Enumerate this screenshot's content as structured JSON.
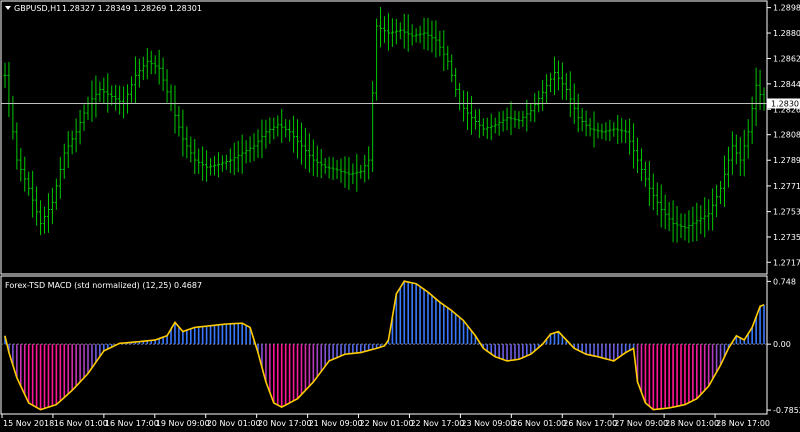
{
  "symbol_header": {
    "symbol": "GBPUSD,H1",
    "ohlc": "1.28327 1.28349 1.28269 1.28301"
  },
  "indicator_header": "Forex-TSD MACD (std normalized) (12,25) 0.4687",
  "price_scale": {
    "ticks": [
      "1.28980",
      "1.28800",
      "1.28620",
      "1.28440",
      "1.28260",
      "1.28080",
      "1.27899",
      "1.27717",
      "1.27535",
      "1.27355",
      "1.27176"
    ],
    "current_price": "1.28301",
    "ylim": [
      1.271,
      1.2902
    ]
  },
  "indicator_scale": {
    "ticks": [
      "0.748",
      "0.00",
      "-0.7852"
    ],
    "ylim": [
      -0.82,
      0.8
    ]
  },
  "time_axis": {
    "labels": [
      "15 Nov 2018",
      "16 Nov 01:00",
      "16 Nov 17:00",
      "19 Nov 09:00",
      "20 Nov 01:00",
      "20 Nov 17:00",
      "21 Nov 09:00",
      "22 Nov 01:00",
      "22 Nov 17:00",
      "23 Nov 09:00",
      "26 Nov 01:00",
      "26 Nov 17:00",
      "27 Nov 09:00",
      "28 Nov 01:00",
      "28 Nov 17:00"
    ]
  },
  "colors": {
    "background": "#000000",
    "bars": "#00c800",
    "frame": "#ffffff",
    "current_line": "#c0c0c0",
    "signal": "#ffcc00",
    "hist_positive": "#3a78ff",
    "hist_negative": "#ff1493",
    "zero_line": "#808080",
    "scale_bg": "#ffffff"
  },
  "chart_data": [
    {
      "type": "ohlc",
      "series": [
        {
          "name": "GBPUSD,H1",
          "anchors": [
            [
              0,
              1.285
            ],
            [
              3,
              1.279
            ],
            [
              6,
              1.277
            ],
            [
              9,
              1.2745
            ],
            [
              12,
              1.276
            ],
            [
              15,
              1.2795
            ],
            [
              18,
              1.281
            ],
            [
              21,
              1.283
            ],
            [
              24,
              1.284
            ],
            [
              27,
              1.2835
            ],
            [
              30,
              1.283
            ],
            [
              33,
              1.285
            ],
            [
              36,
              1.286
            ],
            [
              39,
              1.2855
            ],
            [
              42,
              1.283
            ],
            [
              45,
              1.2805
            ],
            [
              48,
              1.279
            ],
            [
              51,
              1.2785
            ],
            [
              54,
              1.2787
            ],
            [
              57,
              1.279
            ],
            [
              60,
              1.2795
            ],
            [
              63,
              1.28
            ],
            [
              66,
              1.281
            ],
            [
              69,
              1.2815
            ],
            [
              72,
              1.281
            ],
            [
              75,
              1.28
            ],
            [
              78,
              1.279
            ],
            [
              81,
              1.2785
            ],
            [
              84,
              1.2783
            ],
            [
              87,
              1.278
            ],
            [
              90,
              1.2782
            ],
            [
              92,
              1.279
            ],
            [
              94,
              1.2885
            ],
            [
              97,
              1.288
            ],
            [
              100,
              1.2882
            ],
            [
              103,
              1.2878
            ],
            [
              106,
              1.288
            ],
            [
              109,
              1.2875
            ],
            [
              112,
              1.286
            ],
            [
              115,
              1.283
            ],
            [
              118,
              1.282
            ],
            [
              121,
              1.2812
            ],
            [
              124,
              1.2815
            ],
            [
              127,
              1.282
            ],
            [
              130,
              1.2818
            ],
            [
              133,
              1.2825
            ],
            [
              136,
              1.2838
            ],
            [
              139,
              1.2852
            ],
            [
              142,
              1.284
            ],
            [
              145,
              1.282
            ],
            [
              148,
              1.2812
            ],
            [
              151,
              1.281
            ],
            [
              154,
              1.2812
            ],
            [
              157,
              1.281
            ],
            [
              160,
              1.279
            ],
            [
              163,
              1.277
            ],
            [
              166,
              1.2755
            ],
            [
              169,
              1.2745
            ],
            [
              172,
              1.2742
            ],
            [
              175,
              1.2747
            ],
            [
              178,
              1.2752
            ],
            [
              181,
              1.277
            ],
            [
              184,
              1.28
            ],
            [
              186,
              1.279
            ],
            [
              188,
              1.281
            ],
            [
              190,
              1.2843
            ],
            [
              192,
              1.283
            ]
          ]
        }
      ],
      "bar_count": 193
    },
    {
      "type": "bar",
      "series": [
        {
          "name": "Forex-TSD MACD (std normalized)",
          "anchors": [
            [
              0,
              0.1
            ],
            [
              1,
              -0.1
            ],
            [
              3,
              -0.4
            ],
            [
              6,
              -0.7
            ],
            [
              9,
              -0.78
            ],
            [
              13,
              -0.72
            ],
            [
              17,
              -0.55
            ],
            [
              21,
              -0.35
            ],
            [
              25,
              -0.08
            ],
            [
              29,
              0.01
            ],
            [
              34,
              0.03
            ],
            [
              38,
              0.05
            ],
            [
              41,
              0.1
            ],
            [
              43,
              0.26
            ],
            [
              45,
              0.15
            ],
            [
              48,
              0.2
            ],
            [
              52,
              0.22
            ],
            [
              56,
              0.24
            ],
            [
              60,
              0.25
            ],
            [
              62,
              0.2
            ],
            [
              64,
              -0.1
            ],
            [
              66,
              -0.45
            ],
            [
              68,
              -0.7
            ],
            [
              70,
              -0.75
            ],
            [
              74,
              -0.65
            ],
            [
              78,
              -0.45
            ],
            [
              82,
              -0.2
            ],
            [
              86,
              -0.12
            ],
            [
              90,
              -0.1
            ],
            [
              94,
              -0.05
            ],
            [
              96,
              -0.02
            ],
            [
              97,
              0.05
            ],
            [
              99,
              0.6
            ],
            [
              101,
              0.75
            ],
            [
              104,
              0.72
            ],
            [
              107,
              0.62
            ],
            [
              110,
              0.5
            ],
            [
              113,
              0.4
            ],
            [
              116,
              0.28
            ],
            [
              119,
              0.1
            ],
            [
              121,
              -0.05
            ],
            [
              124,
              -0.15
            ],
            [
              127,
              -0.2
            ],
            [
              130,
              -0.18
            ],
            [
              133,
              -0.12
            ],
            [
              136,
              0.0
            ],
            [
              138,
              0.12
            ],
            [
              140,
              0.15
            ],
            [
              142,
              0.05
            ],
            [
              144,
              -0.05
            ],
            [
              147,
              -0.12
            ],
            [
              150,
              -0.15
            ],
            [
              154,
              -0.2
            ],
            [
              157,
              -0.1
            ],
            [
              159,
              -0.05
            ],
            [
              160,
              -0.45
            ],
            [
              162,
              -0.7
            ],
            [
              164,
              -0.78
            ],
            [
              168,
              -0.76
            ],
            [
              172,
              -0.72
            ],
            [
              175,
              -0.65
            ],
            [
              178,
              -0.5
            ],
            [
              181,
              -0.25
            ],
            [
              183,
              -0.05
            ],
            [
              185,
              0.1
            ],
            [
              187,
              0.05
            ],
            [
              189,
              0.2
            ],
            [
              191,
              0.45
            ],
            [
              192,
              0.47
            ]
          ]
        }
      ],
      "bar_count": 193
    }
  ]
}
